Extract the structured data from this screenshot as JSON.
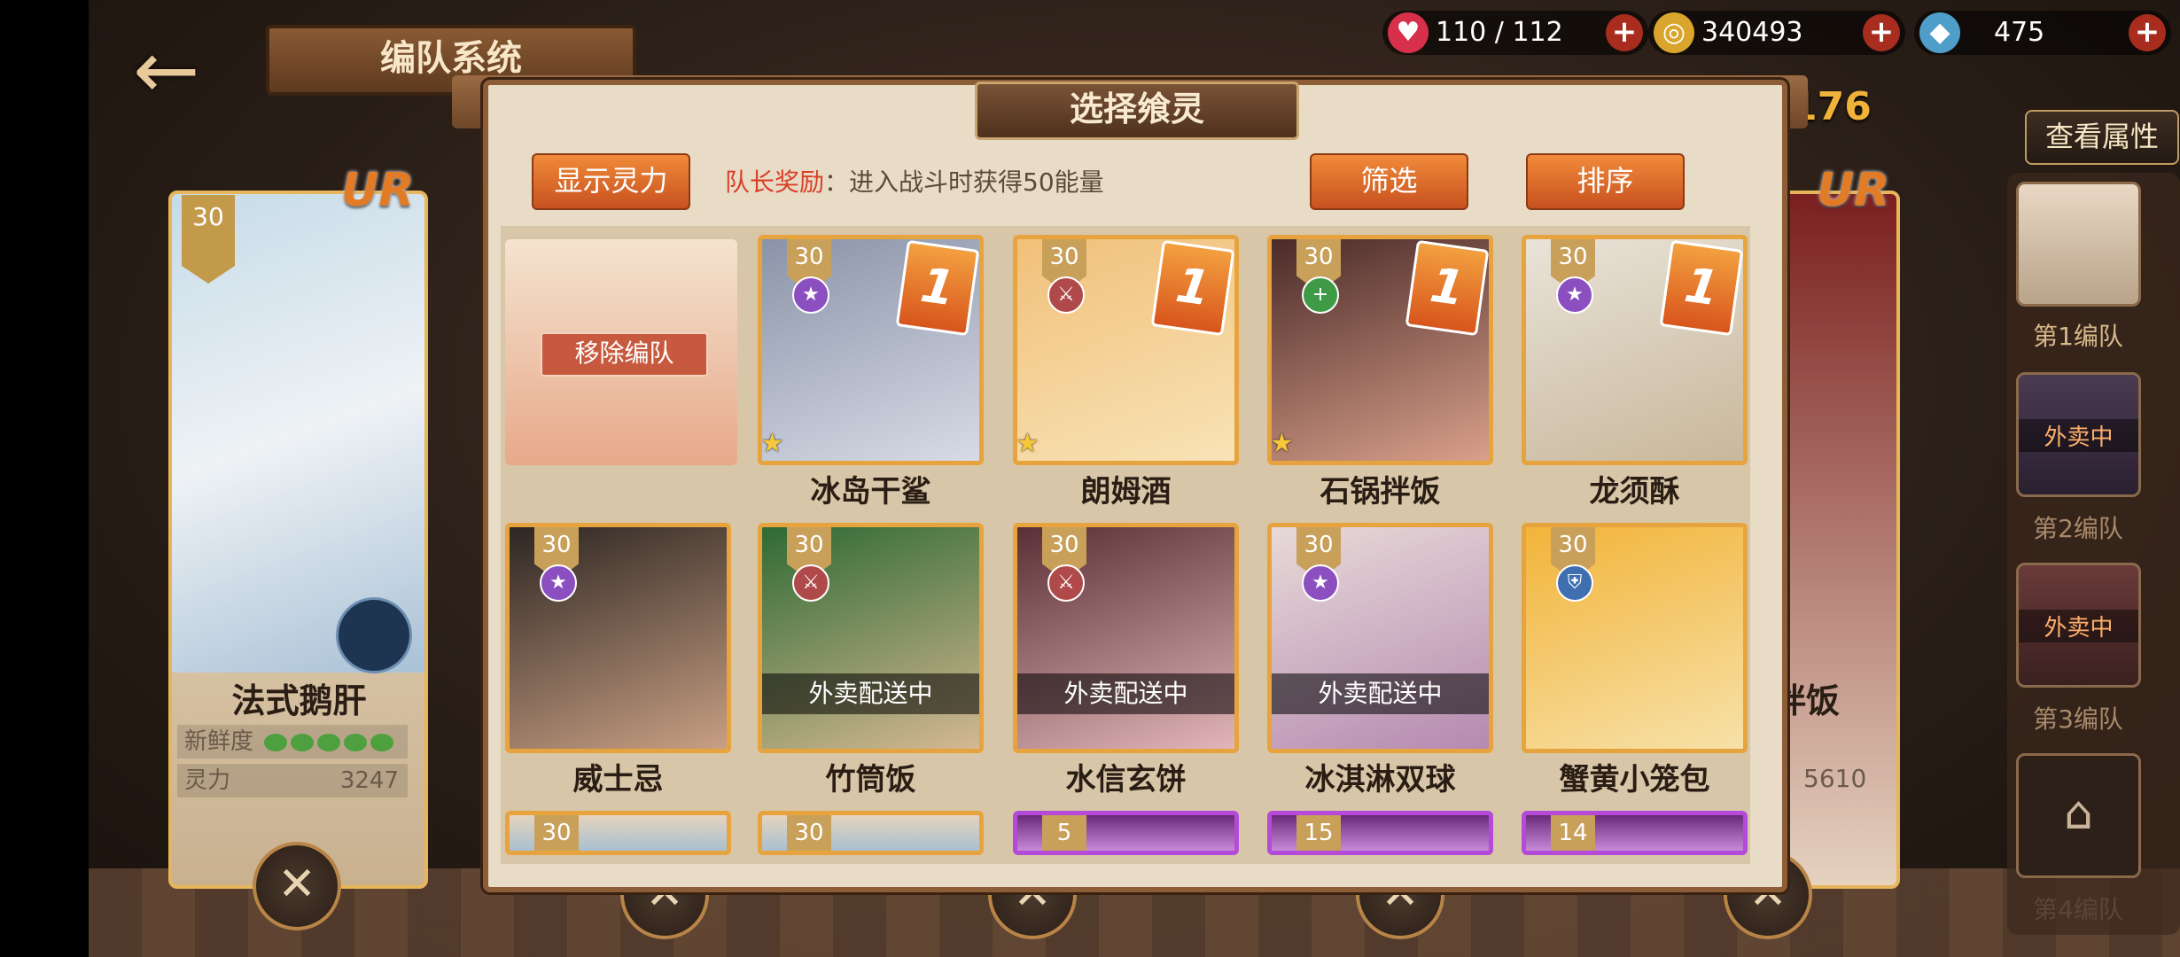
{
  "header": {
    "title": "编队系统",
    "back_icon": "←",
    "resources": [
      {
        "name": "stamina",
        "icon": "heart-icon",
        "value": "110 / 112"
      },
      {
        "name": "gold",
        "icon": "coin-icon",
        "value": "340493"
      },
      {
        "name": "crystal",
        "icon": "crystal-icon",
        "value": "475"
      }
    ],
    "plus": "+",
    "counter": "176",
    "view_attributes": "查看属性"
  },
  "left_card": {
    "rarity": "UR",
    "level": "30",
    "name": "法式鹅肝",
    "freshness_label": "新鲜度",
    "power_label": "灵力",
    "power_value": "3247"
  },
  "right_card": {
    "rarity": "UR",
    "name_partial": "拌饭",
    "power_value": "5610"
  },
  "teams": [
    {
      "label": "第1编队",
      "status": ""
    },
    {
      "label": "第2编队",
      "status": "外卖中"
    },
    {
      "label": "第3编队",
      "status": "外卖中"
    },
    {
      "label": "第4编队",
      "status": ""
    }
  ],
  "dialog": {
    "title": "选择飨灵",
    "show_power_button": "显示灵力",
    "leader_bonus_label": "队长奖励",
    "leader_bonus_text": "：进入战斗时获得50能量",
    "filter_button": "筛选",
    "sort_button": "排序",
    "remove_button": "移除编队"
  },
  "characters": [
    {
      "name": "冰岛干鲨",
      "level": "30",
      "attr": "★",
      "dup": "1",
      "star": true,
      "busy": "",
      "colors": [
        "#8a93a8",
        "#d7dbe6"
      ]
    },
    {
      "name": "朗姆酒",
      "level": "30",
      "attr": "⚔",
      "dup": "1",
      "star": true,
      "busy": "",
      "colors": [
        "#f1c07a",
        "#f8e3b6"
      ]
    },
    {
      "name": "石锅拌饭",
      "level": "30",
      "attr": "+",
      "dup": "1",
      "star": true,
      "busy": "",
      "colors": [
        "#4a2a28",
        "#d9a08a"
      ]
    },
    {
      "name": "龙须酥",
      "level": "30",
      "attr": "★",
      "dup": "1",
      "star": false,
      "busy": "",
      "colors": [
        "#e9e3d8",
        "#c8b79b"
      ]
    },
    {
      "name": "威士忌",
      "level": "30",
      "attr": "★",
      "dup": "",
      "star": false,
      "busy": "",
      "colors": [
        "#2d2622",
        "#c89f83"
      ]
    },
    {
      "name": "竹筒饭",
      "level": "30",
      "attr": "⚔",
      "dup": "",
      "star": false,
      "busy": "外卖配送中",
      "colors": [
        "#2f6a33",
        "#d4b892"
      ]
    },
    {
      "name": "水信玄饼",
      "level": "30",
      "attr": "⚔",
      "dup": "",
      "star": false,
      "busy": "外卖配送中",
      "colors": [
        "#5a2f35",
        "#e2b6b8"
      ]
    },
    {
      "name": "冰淇淋双球",
      "level": "30",
      "attr": "★",
      "dup": "",
      "star": false,
      "busy": "外卖配送中",
      "colors": [
        "#e8dad8",
        "#b58ab0"
      ]
    },
    {
      "name": "蟹黄小笼包",
      "level": "30",
      "attr": "⛨",
      "dup": "",
      "star": false,
      "busy": "",
      "colors": [
        "#f2b43a",
        "#f7e1a8"
      ]
    }
  ],
  "partial_levels": [
    "30",
    "30",
    "5",
    "15",
    "14"
  ],
  "colors": {
    "accent": "#e27b25",
    "button": "#d8641f",
    "frame": "#8c5d36"
  }
}
